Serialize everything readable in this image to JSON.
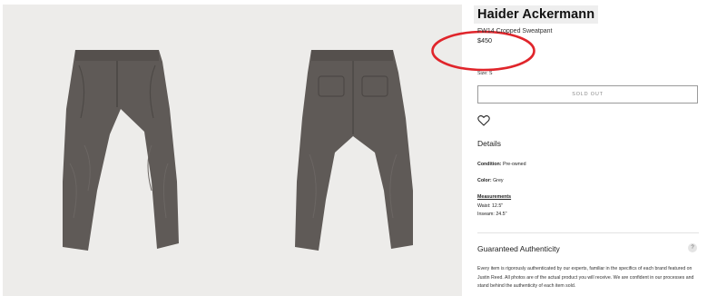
{
  "product": {
    "brand": "Haider Ackermann",
    "name": "FW14 Cropped Sweatpant",
    "price": "$450",
    "size_label": "Size: S",
    "sold_out_label": "SOLD OUT",
    "wishlist_icon": "heart-icon"
  },
  "details": {
    "heading": "Details",
    "condition_key": "Condition:",
    "condition_value": " Pre-owned",
    "color_key": "Color:",
    "color_value": " Grey",
    "measurements_heading": "Measurements",
    "waist": "Waist: 12.5\"",
    "inseam": "Inseam: 24.5\""
  },
  "authenticity": {
    "heading": "Guaranteed Authenticity",
    "help_icon_label": "?",
    "text": "Every item is rigorously authenticated by our experts, familiar in the specifics of each brand featured on Justin Reed. All photos are of the actual product you will receive. We are confident in our processes and stand behind the authenticity of each item sold."
  },
  "colors": {
    "annotation": "#e0252b",
    "garment": "#5f5a57",
    "gallery_bg": "#edecea"
  }
}
